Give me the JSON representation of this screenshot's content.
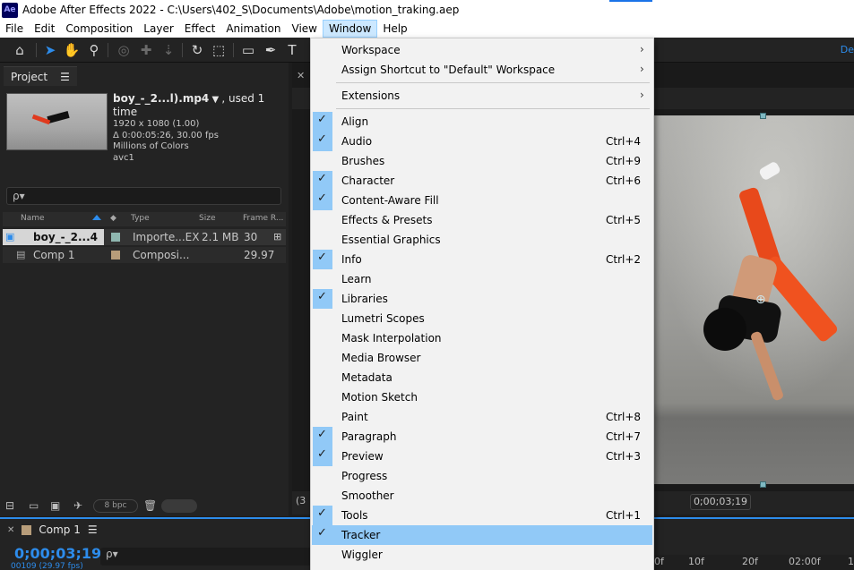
{
  "app": {
    "logo_text": "Ae",
    "title": "Adobe After Effects 2022 - C:\\Users\\402_S\\Documents\\Adobe\\motion_traking.aep"
  },
  "menubar": [
    "File",
    "Edit",
    "Composition",
    "Layer",
    "Effect",
    "Animation",
    "View",
    "Window",
    "Help"
  ],
  "active_menu": "Window",
  "toolbar": {
    "right_label": "De"
  },
  "project": {
    "tab_label": "Project",
    "file_name": "boy_-_2...l).mp4",
    "used": ", used 1 time",
    "resolution": "1920 x 1080 (1.00)",
    "duration": "Δ 0:00:05:26, 30.00 fps",
    "colors": "Millions of Colors",
    "codec": "avc1",
    "search_icon": "ρ▾",
    "columns": [
      "Name",
      "Type",
      "Size",
      "Frame R..."
    ],
    "rows": [
      {
        "name": "boy_-_2...4",
        "type": "Importe...EX",
        "size": "2.1 MB",
        "frame_rate": "30",
        "swatch": "#8fb7b0"
      },
      {
        "name": "Comp 1",
        "type": "Composi...",
        "size": "",
        "frame_rate": "29.97",
        "swatch": "#b79d7a"
      }
    ],
    "bpc": "8 bpc"
  },
  "viewer": {
    "timecode": "0;00;03;19",
    "left_partial": "(3"
  },
  "timeline": {
    "tab_label": "Comp 1",
    "timecode": "0;00;03;19",
    "timecode_sub": "00109 (29.97 fps)",
    "search_icon": "ρ▾",
    "ruler": [
      "0f",
      "10f",
      "20f",
      "02:00f",
      "1"
    ]
  },
  "window_menu": {
    "items": [
      {
        "label": "Workspace",
        "shortcut": "",
        "checked": false,
        "submenu": true
      },
      {
        "label": "Assign Shortcut to \"Default\" Workspace",
        "shortcut": "",
        "checked": false,
        "submenu": true
      },
      {
        "label": "Extensions",
        "shortcut": "",
        "checked": false,
        "submenu": true
      },
      {
        "label": "Align",
        "shortcut": "",
        "checked": true,
        "submenu": false
      },
      {
        "label": "Audio",
        "shortcut": "Ctrl+4",
        "checked": true,
        "submenu": false
      },
      {
        "label": "Brushes",
        "shortcut": "Ctrl+9",
        "checked": false,
        "submenu": false
      },
      {
        "label": "Character",
        "shortcut": "Ctrl+6",
        "checked": true,
        "submenu": false
      },
      {
        "label": "Content-Aware Fill",
        "shortcut": "",
        "checked": true,
        "submenu": false
      },
      {
        "label": "Effects & Presets",
        "shortcut": "Ctrl+5",
        "checked": false,
        "submenu": false
      },
      {
        "label": "Essential Graphics",
        "shortcut": "",
        "checked": false,
        "submenu": false
      },
      {
        "label": "Info",
        "shortcut": "Ctrl+2",
        "checked": true,
        "submenu": false
      },
      {
        "label": "Learn",
        "shortcut": "",
        "checked": false,
        "submenu": false
      },
      {
        "label": "Libraries",
        "shortcut": "",
        "checked": true,
        "submenu": false
      },
      {
        "label": "Lumetri Scopes",
        "shortcut": "",
        "checked": false,
        "submenu": false
      },
      {
        "label": "Mask Interpolation",
        "shortcut": "",
        "checked": false,
        "submenu": false
      },
      {
        "label": "Media Browser",
        "shortcut": "",
        "checked": false,
        "submenu": false
      },
      {
        "label": "Metadata",
        "shortcut": "",
        "checked": false,
        "submenu": false
      },
      {
        "label": "Motion Sketch",
        "shortcut": "",
        "checked": false,
        "submenu": false
      },
      {
        "label": "Paint",
        "shortcut": "Ctrl+8",
        "checked": false,
        "submenu": false
      },
      {
        "label": "Paragraph",
        "shortcut": "Ctrl+7",
        "checked": true,
        "submenu": false
      },
      {
        "label": "Preview",
        "shortcut": "Ctrl+3",
        "checked": true,
        "submenu": false
      },
      {
        "label": "Progress",
        "shortcut": "",
        "checked": false,
        "submenu": false
      },
      {
        "label": "Smoother",
        "shortcut": "",
        "checked": false,
        "submenu": false
      },
      {
        "label": "Tools",
        "shortcut": "Ctrl+1",
        "checked": true,
        "submenu": false
      },
      {
        "label": "Tracker",
        "shortcut": "",
        "checked": true,
        "submenu": false,
        "highlighted": true
      },
      {
        "label": "Wiggler",
        "shortcut": "",
        "checked": false,
        "submenu": false
      }
    ]
  },
  "colors": {
    "accent": "#2d8ceb",
    "menu_highlight": "#91c9f7",
    "panel_bg": "#232323"
  }
}
